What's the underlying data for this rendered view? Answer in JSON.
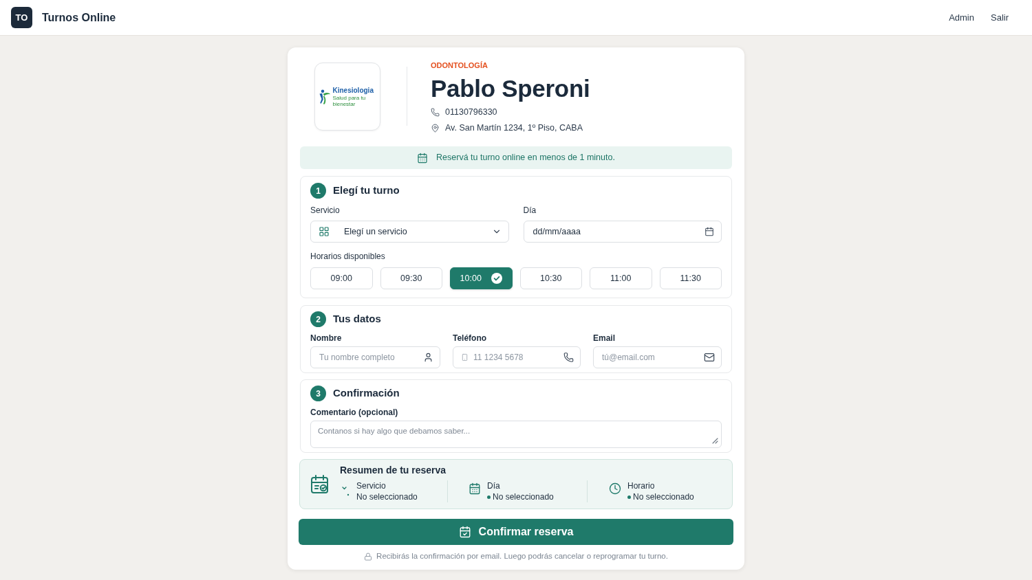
{
  "header": {
    "logo_badge": "TO",
    "title": "Turnos Online",
    "nav": [
      "Admin",
      "Salir"
    ]
  },
  "profile": {
    "logo": {
      "name": "Kinesiologia",
      "tagline": "Salud para tu bienestar"
    },
    "specialty": "ODONTOLOGÍA",
    "name": "Pablo Speroni",
    "phone": "01130796330",
    "address": "Av. San Martín 1234, 1º Piso, CABA"
  },
  "banner": "Reservá tu turno online en menos de 1 minuto.",
  "step_1": {
    "number": "1",
    "title": "Elegí tu turno",
    "service": {
      "label": "Servicio",
      "placeholder": "Elegí un servicio"
    },
    "day": {
      "label": "Día",
      "placeholder": "dd/mm/aaaa"
    },
    "slots_label": "Horarios disponibles",
    "slots": [
      {
        "time": "09:00",
        "selected": false
      },
      {
        "time": "09:30",
        "selected": false
      },
      {
        "time": "10:00",
        "selected": true
      },
      {
        "time": "10:30",
        "selected": false
      },
      {
        "time": "11:00",
        "selected": false
      },
      {
        "time": "11:30",
        "selected": false
      }
    ]
  },
  "step_2": {
    "number": "2",
    "title": "Tus datos",
    "fields": [
      {
        "kind": "name",
        "label": "Nombre",
        "placeholder": "Tu nombre completo"
      },
      {
        "kind": "phone",
        "label": "Teléfono",
        "placeholder": "11 1234 5678"
      },
      {
        "kind": "email",
        "label": "Email",
        "placeholder": "tú@email.com"
      }
    ]
  },
  "step_3": {
    "number": "3",
    "title": "Confirmación",
    "comment": {
      "label": "Comentario (opcional)",
      "placeholder": "Contanos si hay algo que debamos saber..."
    }
  },
  "summary": {
    "title": "Resumen de tu reserva",
    "items": [
      {
        "kind": "service",
        "label": "Servicio",
        "value": "No seleccionado"
      },
      {
        "kind": "day",
        "label": "Día",
        "value": "No seleccionado"
      },
      {
        "kind": "time",
        "label": "Horario",
        "value": "No seleccionado"
      }
    ]
  },
  "confirm_button": "Confirmar reserva",
  "footnote": "Recibirás la confirmación por email. Luego podrás cancelar o reprogramar tu turno."
}
